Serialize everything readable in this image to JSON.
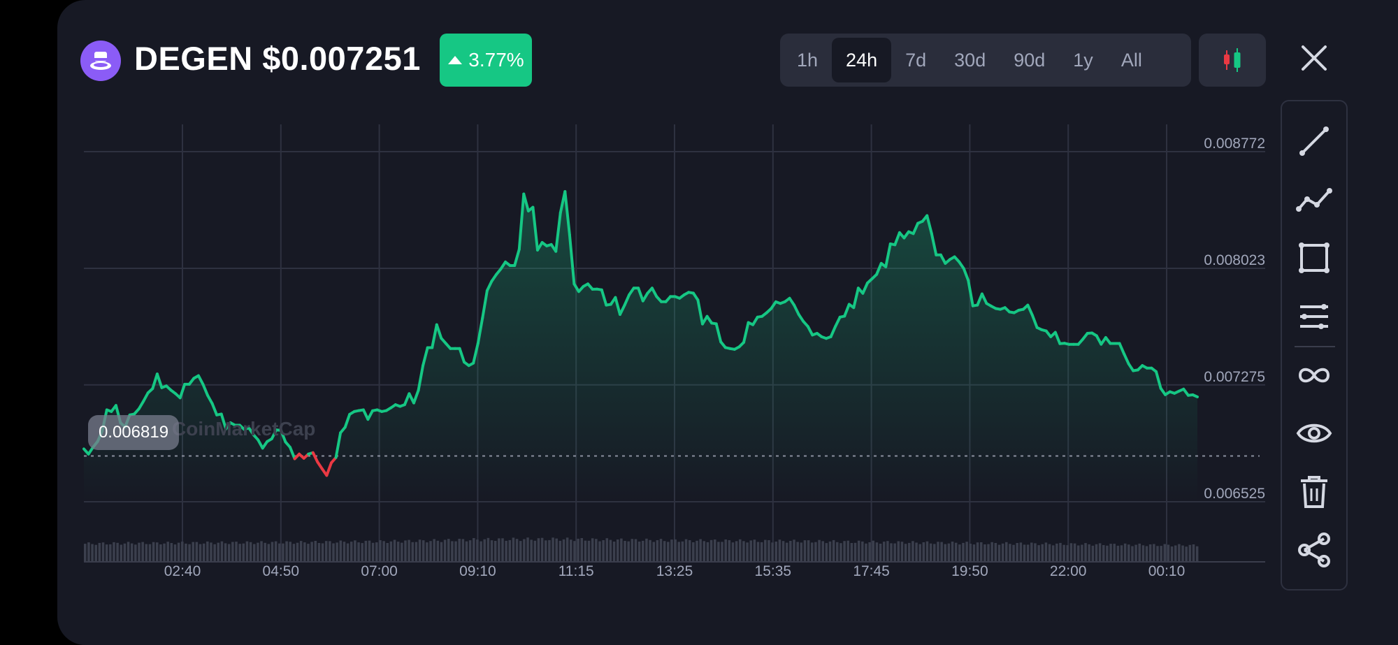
{
  "header": {
    "title": "DEGEN $0.007251",
    "change": "3.77%",
    "change_direction": "up",
    "ranges": [
      "1h",
      "24h",
      "7d",
      "30d",
      "90d",
      "1y",
      "All"
    ],
    "active_range": "24h",
    "candle_toggle_icon": "candlestick-icon",
    "close_icon": "close-icon"
  },
  "tools": [
    {
      "name": "trend-line-icon"
    },
    {
      "name": "polyline-icon"
    },
    {
      "name": "rectangle-icon"
    },
    {
      "name": "horizontal-lines-icon"
    },
    {
      "name": "infinity-icon"
    },
    {
      "name": "eye-icon"
    },
    {
      "name": "trash-icon"
    },
    {
      "name": "share-icon"
    }
  ],
  "watermark": "CoinMarketCap",
  "colors": {
    "up": "#16c784",
    "down": "#ea3943",
    "background": "#171924",
    "grid": "#2e3140",
    "accent_purple": "#8b5cf6"
  },
  "chart_data": {
    "type": "line",
    "y_ticks": [
      "0.008772",
      "0.008023",
      "0.007275",
      "0.006525"
    ],
    "x_ticks": [
      "02:40",
      "04:50",
      "07:00",
      "09:10",
      "11:15",
      "13:25",
      "15:35",
      "17:45",
      "19:50",
      "22:00",
      "00:10"
    ],
    "reference_value": 0.006819,
    "reference_label": "0.006819",
    "ylim": [
      0.006525,
      0.008772
    ],
    "series": [
      {
        "values": [
          0.006864,
          0.006831,
          0.006875,
          0.006912,
          0.006978,
          0.007115,
          0.007104,
          0.007143,
          0.007032,
          0.007005,
          0.007082,
          0.007088,
          0.007121,
          0.00717,
          0.007224,
          0.007251,
          0.007345,
          0.007257,
          0.007268,
          0.007241,
          0.007219,
          0.007192,
          0.007279,
          0.007279,
          0.007317,
          0.007334,
          0.007279,
          0.007208,
          0.007155,
          0.007082,
          0.007088,
          0.006993,
          0.007032,
          0.007016,
          0.007016,
          0.006989,
          0.006999,
          0.006955,
          0.006923,
          0.006869,
          0.006911,
          0.006929,
          0.006986,
          0.006984,
          0.006909,
          0.006875,
          0.006801,
          0.006831,
          0.006804,
          0.006831,
          0.00684,
          0.00678,
          0.006736,
          0.006694,
          0.006775,
          0.006809,
          0.006967,
          0.007003,
          0.007086,
          0.007104,
          0.00711,
          0.007115,
          0.007054,
          0.007109,
          0.007115,
          0.007104,
          0.00711,
          0.007128,
          0.007148,
          0.007137,
          0.007148,
          0.007219,
          0.007159,
          0.007241,
          0.007399,
          0.007514,
          0.007514,
          0.007661,
          0.007574,
          0.007541,
          0.007508,
          0.007508,
          0.007508,
          0.007421,
          0.007399,
          0.007415,
          0.007541,
          0.007705,
          0.00788,
          0.00794,
          0.007983,
          0.00802,
          0.008064,
          0.008041,
          0.008041,
          0.008145,
          0.0085,
          0.008391,
          0.008415,
          0.00814,
          0.008189,
          0.008167,
          0.008176,
          0.008132,
          0.00838,
          0.008516,
          0.008238,
          0.007923,
          0.007874,
          0.007907,
          0.007923,
          0.007889,
          0.00789,
          0.007885,
          0.007787,
          0.007792,
          0.007836,
          0.007727,
          0.007787,
          0.007853,
          0.007896,
          0.007896,
          0.007814,
          0.007863,
          0.007896,
          0.007842,
          0.007809,
          0.007809,
          0.007842,
          0.007842,
          0.007831,
          0.007853,
          0.007869,
          0.007864,
          0.00782,
          0.007666,
          0.007715,
          0.007672,
          0.007667,
          0.007551,
          0.007515,
          0.007508,
          0.007503,
          0.007519,
          0.007548,
          0.007675,
          0.007661,
          0.00771,
          0.007715,
          0.007738,
          0.007765,
          0.007808,
          0.007798,
          0.007809,
          0.007831,
          0.007787,
          0.007727,
          0.007683,
          0.00765,
          0.007595,
          0.007606,
          0.007584,
          0.007573,
          0.007584,
          0.00765,
          0.00771,
          0.007716,
          0.007792,
          0.007771,
          0.007896,
          0.007863,
          0.007929,
          0.007956,
          0.007984,
          0.008055,
          0.008033,
          0.00818,
          0.008174,
          0.008252,
          0.008218,
          0.008258,
          0.008246,
          0.008312,
          0.008325,
          0.008361,
          0.008246,
          0.008109,
          0.008109,
          0.008055,
          0.00808,
          0.008097,
          0.008065,
          0.008022,
          0.007946,
          0.007782,
          0.007787,
          0.007859,
          0.007798,
          0.007781,
          0.007765,
          0.00776,
          0.007771,
          0.007743,
          0.007738,
          0.007754,
          0.00776,
          0.007787,
          0.007721,
          0.007643,
          0.007629,
          0.007621,
          0.007584,
          0.007612,
          0.00754,
          0.007542,
          0.007535,
          0.007535,
          0.007535,
          0.007568,
          0.007606,
          0.007608,
          0.00759,
          0.007536,
          0.007579,
          0.007541,
          0.007541,
          0.007541,
          0.007474,
          0.00741,
          0.007366,
          0.007371,
          0.007399,
          0.007383,
          0.007383,
          0.00736,
          0.007253,
          0.007212,
          0.007231,
          0.007221,
          0.007235,
          0.007248,
          0.007208,
          0.007211,
          0.007198
        ]
      },
      {
        "name": "volume",
        "values": [
          0.82,
          0.84,
          0.85,
          0.86,
          0.87,
          0.88,
          0.9,
          0.92,
          0.95,
          1.0,
          1.02,
          1.03,
          1.0,
          0.98,
          0.96,
          0.95,
          0.94,
          0.93,
          0.9,
          0.88,
          0.86,
          0.84,
          0.82,
          0.8,
          0.78,
          0.76,
          0.74
        ]
      }
    ]
  }
}
